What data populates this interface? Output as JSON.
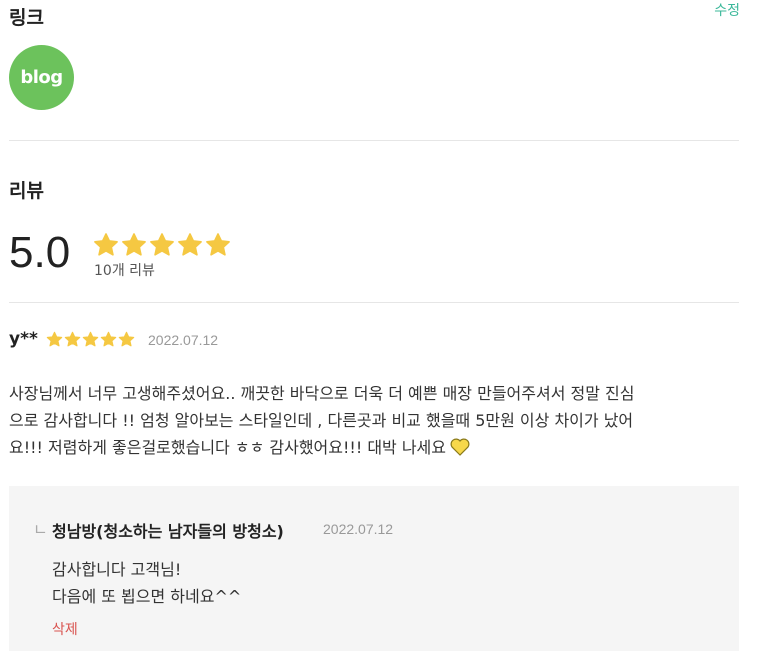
{
  "links": {
    "title": "링크",
    "edit_label": "수정",
    "blog_label": "blog"
  },
  "reviews": {
    "title": "리뷰",
    "rating": "5.0",
    "rating_stars": 5,
    "count_label": "10개 리뷰",
    "star_color": "#f5c842"
  },
  "review": {
    "author": "y**",
    "stars": 5,
    "date": "2022.07.12",
    "lines": [
      "사장님께서 너무 고생해주셨어요.. 깨끗한 바닥으로 더욱 더 예쁜 매장 만들어주셔서 정말 진심",
      "으로 감사합니다 !! 엄청 알아보는 스타일인데 , 다른곳과 비교 했을때 5만원 이상 차이가 났어",
      "요!!! 저렴하게 좋은걸로했습니다 ㅎㅎ 감사했어요!!! 대박 나세요"
    ]
  },
  "reply": {
    "marker": "ㄴ",
    "author": "청남방(청소하는 남자들의 방청소)",
    "date": "2022.07.12",
    "text": "감사합니다 고객님!\n다음에 또 뵙으면 하네요^^",
    "delete_label": "삭제"
  }
}
